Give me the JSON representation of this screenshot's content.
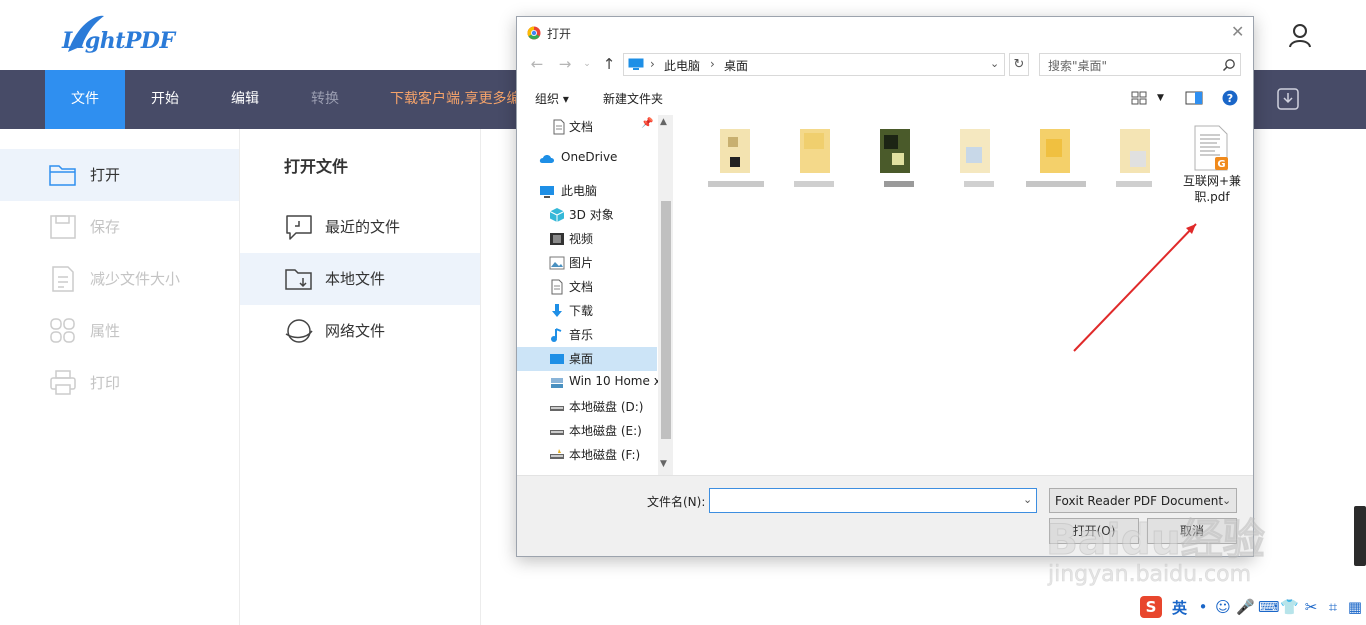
{
  "app": {
    "logo_text": "LightPDF",
    "nav": [
      {
        "label": "文件",
        "state": "active"
      },
      {
        "label": "开始",
        "state": "normal"
      },
      {
        "label": "编辑",
        "state": "normal"
      },
      {
        "label": "转换",
        "state": "disabled"
      }
    ],
    "promo": "下载客户端,享更多编",
    "left_menu": [
      {
        "label": "打开",
        "icon": "folder-icon",
        "state": "active"
      },
      {
        "label": "保存",
        "icon": "save-icon",
        "state": "disabled"
      },
      {
        "label": "减少文件大小",
        "icon": "compress-icon",
        "state": "disabled"
      },
      {
        "label": "属性",
        "icon": "properties-icon",
        "state": "disabled"
      },
      {
        "label": "打印",
        "icon": "printer-icon",
        "state": "disabled"
      }
    ],
    "mid_panel": {
      "title": "打开文件",
      "items": [
        {
          "label": "最近的文件",
          "icon": "recent-files-icon",
          "state": "normal"
        },
        {
          "label": "本地文件",
          "icon": "local-folder-icon",
          "state": "active"
        },
        {
          "label": "网络文件",
          "icon": "cloud-globe-icon",
          "state": "normal"
        }
      ]
    }
  },
  "dialog": {
    "title": "打开",
    "breadcrumb": [
      "此电脑",
      "桌面"
    ],
    "search_placeholder": "搜索\"桌面\"",
    "toolbar": {
      "organize": "组织",
      "new_folder": "新建文件夹"
    },
    "nav_pane": [
      {
        "label": "文档",
        "icon": "document-icon",
        "indent": 2,
        "pinned": true
      },
      {
        "label": "OneDrive",
        "icon": "onedrive-icon",
        "indent": 1
      },
      {
        "label": "此电脑",
        "icon": "pc-icon",
        "indent": 1
      },
      {
        "label": "3D 对象",
        "icon": "cube-3d-icon",
        "indent": 2
      },
      {
        "label": "视频",
        "icon": "video-icon",
        "indent": 2
      },
      {
        "label": "图片",
        "icon": "picture-icon",
        "indent": 2
      },
      {
        "label": "文档",
        "icon": "document-icon",
        "indent": 2
      },
      {
        "label": "下载",
        "icon": "download-arrow-icon",
        "indent": 2
      },
      {
        "label": "音乐",
        "icon": "music-icon",
        "indent": 2
      },
      {
        "label": "桌面",
        "icon": "desktop-icon",
        "indent": 2,
        "selected": true
      },
      {
        "label": "Win 10 Home x",
        "icon": "network-drive-icon",
        "indent": 2
      },
      {
        "label": "本地磁盘 (D:)",
        "icon": "drive-icon",
        "indent": 2
      },
      {
        "label": "本地磁盘 (E:)",
        "icon": "drive-icon",
        "indent": 2
      },
      {
        "label": "本地磁盘 (F:)",
        "icon": "drive-icon",
        "indent": 2
      }
    ],
    "pdf_file_name": "互联网+兼职.pdf",
    "filename_label": "文件名(N):",
    "filename_value": "",
    "file_type": "Foxit Reader PDF Document",
    "open_button": "打开(O)",
    "cancel_button": "取消"
  },
  "watermark": {
    "brand": "Baidu经验",
    "url": "jingyan.baidu.com"
  },
  "ime": {
    "lang": "英",
    "logo": "S"
  },
  "colors": {
    "nav_bg": "#474b67",
    "accent": "#2f8ff0",
    "promo": "#f5a36a",
    "arrow": "#e02a2a"
  }
}
